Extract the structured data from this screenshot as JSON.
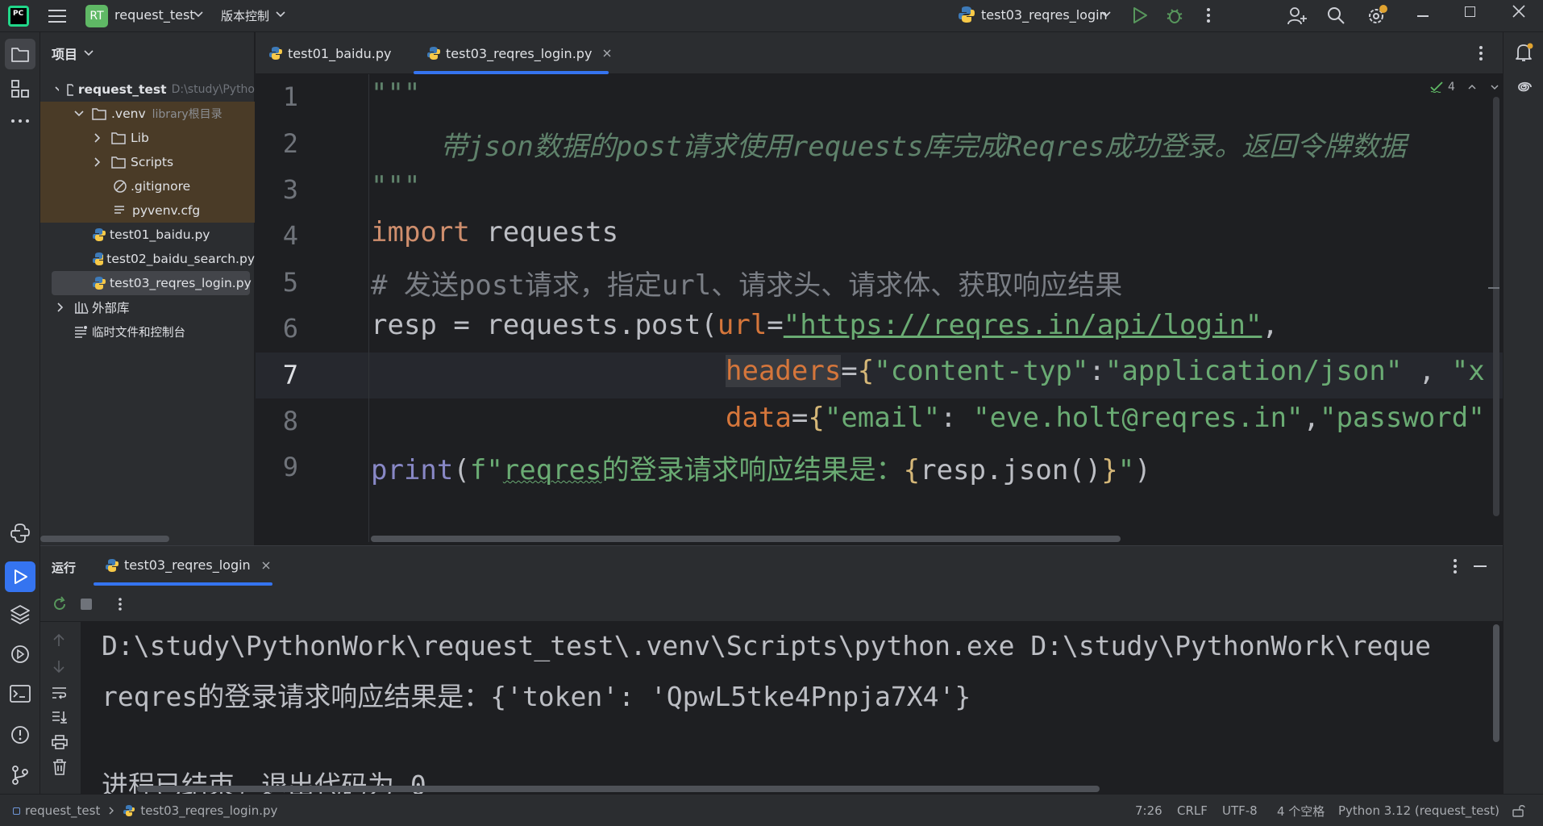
{
  "titlebar": {
    "project_badge": "RT",
    "project_name": "request_test",
    "vcs_menu": "版本控制",
    "run_config": "test03_reqres_login"
  },
  "project_panel": {
    "title": "项目",
    "root": {
      "name": "request_test",
      "path": "D:\\study\\Pytho"
    },
    "venv": {
      "name": ".venv",
      "hint": "library根目录"
    },
    "venv_children": [
      "Lib",
      "Scripts",
      ".gitignore",
      "pyvenv.cfg"
    ],
    "files": [
      "test01_baidu.py",
      "test02_baidu_search.py",
      "test03_reqres_login.py"
    ],
    "external_libs": "外部库",
    "scratches": "临时文件和控制台"
  },
  "editor": {
    "tabs": [
      "test01_baidu.py",
      "test03_reqres_login.py"
    ],
    "active_tab": 1,
    "inspection_count": "4",
    "line_numbers": [
      "1",
      "2",
      "3",
      "4",
      "5",
      "6",
      "7",
      "8",
      "9"
    ],
    "lines": {
      "l1": "\"\"\"",
      "l2": "带json数据的post请求使用requests库完成Reqres成功登录。返回令牌数据",
      "l3": "\"\"\"",
      "l4_kw": "import",
      "l4_rest": " requests",
      "l5": "# 发送post请求，指定url、请求头、请求体、获取响应结果",
      "l6_a": "resp = requests.post(",
      "l6_param": "url",
      "l6_eq": "=",
      "l6_str": "\"https://reqres.in/api/login\"",
      "l6_end": ",",
      "l7_param": "headers",
      "l7_eq": "=",
      "l7_brace": "{",
      "l7_str1": "\"content-typ\"",
      "l7_colon": ":",
      "l7_str2": "\"application/json\"",
      "l7_sep": " , ",
      "l7_str3": "\"x",
      "l8_param": "data",
      "l8_eq": "=",
      "l8_brace": "{",
      "l8_str1": "\"email\"",
      "l8_colon": ": ",
      "l8_str2": "\"eve.holt@reqres.in\"",
      "l8_comma": ",",
      "l8_str3": "\"password\"",
      "l9_builtin": "print",
      "l9_open": "(",
      "l9_f": "f\"",
      "l9_reqres": "reqres",
      "l9_text": "的登录请求响应结果是：",
      "l9_brace_open": "{",
      "l9_expr": "resp.json()",
      "l9_brace_close": "}",
      "l9_quote": "\"",
      "l9_close": ")"
    }
  },
  "run_panel": {
    "title": "运行",
    "tab": "test03_reqres_login",
    "output": [
      "D:\\study\\PythonWork\\request_test\\.venv\\Scripts\\python.exe D:\\study\\PythonWork\\reque",
      "reqres的登录请求响应结果是：{'token': 'QpwL5tke4Pnpja7X4'}",
      "",
      "进程已结束，退出代码为 0"
    ]
  },
  "statusbar": {
    "project": "request_test",
    "file": "test03_reqres_login.py",
    "position": "7:26",
    "line_sep": "CRLF",
    "encoding": "UTF-8",
    "indent": "4 个空格",
    "interpreter": "Python 3.12 (request_test)"
  },
  "colors": {
    "background": "#1e1f22",
    "panel": "#2b2d30",
    "keyword": "#cf8e6d",
    "string": "#6aab73",
    "parameter": "#d5763b",
    "accent": "#3574f0"
  }
}
